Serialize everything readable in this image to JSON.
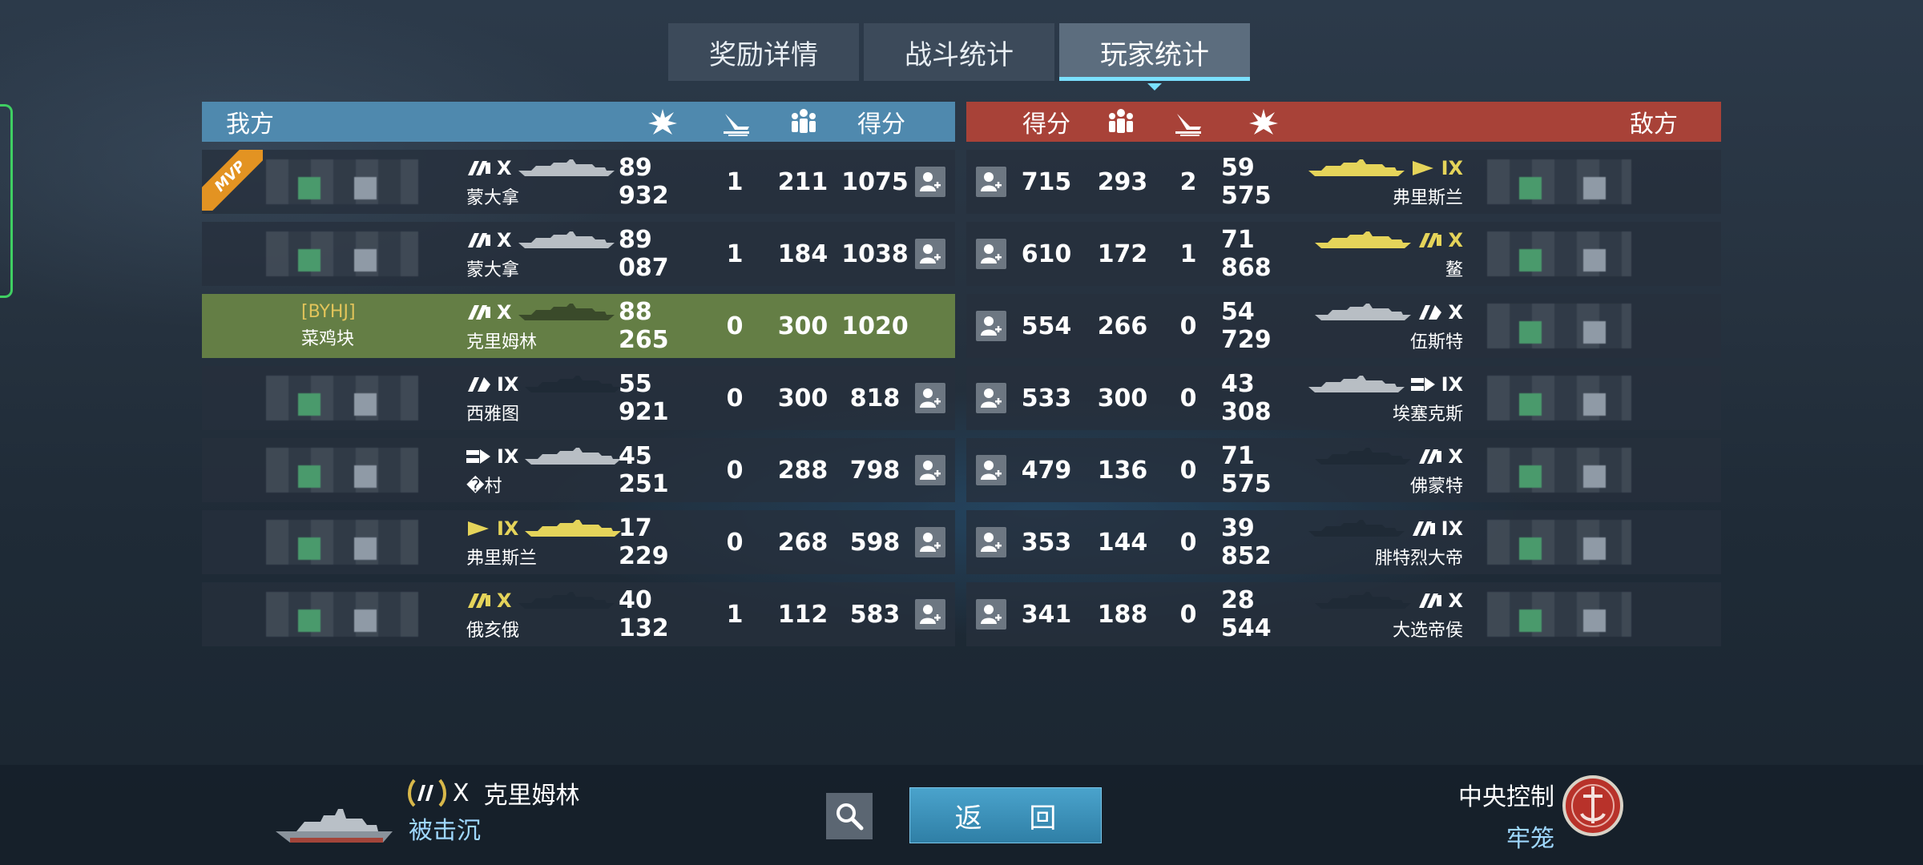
{
  "tabs": [
    {
      "label": "奖励详情",
      "active": false
    },
    {
      "label": "战斗统计",
      "active": false
    },
    {
      "label": "玩家统计",
      "active": true
    }
  ],
  "ally": {
    "title": "我方",
    "score_label": "得分",
    "rows": [
      {
        "mvp": true,
        "mvp_label": "MVP",
        "clan": "",
        "player": "",
        "ship_class": "double-slash",
        "tier": "X",
        "ship": "蒙大拿",
        "ship_color": "#b8bec4",
        "damage": "89 932",
        "kills": "1",
        "spotting": "211",
        "score": "1075",
        "self": false,
        "class_color": "#ffffff"
      },
      {
        "mvp": false,
        "clan": "",
        "player": "",
        "ship_class": "double-slash",
        "tier": "X",
        "ship": "蒙大拿",
        "ship_color": "#b8bec4",
        "damage": "89 087",
        "kills": "1",
        "spotting": "184",
        "score": "1038",
        "self": false,
        "class_color": "#ffffff"
      },
      {
        "mvp": false,
        "clan": "[BYHJ]",
        "player": "菜鸡块",
        "ship_class": "double-slash",
        "tier": "X",
        "ship": "克里姆林",
        "ship_color": "#3a4a2a",
        "damage": "88 265",
        "kills": "0",
        "spotting": "300",
        "score": "1020",
        "self": true,
        "class_color": "#ffffff"
      },
      {
        "mvp": false,
        "clan": "",
        "player": "",
        "ship_class": "single-slash",
        "tier": "IX",
        "ship": "西雅图",
        "ship_color": "#1f2a36",
        "damage": "55 921",
        "kills": "0",
        "spotting": "300",
        "score": "818",
        "self": false,
        "class_color": "#ffffff"
      },
      {
        "mvp": false,
        "clan": "",
        "player": "",
        "ship_class": "arrow",
        "tier": "IX",
        "ship": "�村",
        "ship_color": "#b8bec4",
        "damage": "45 251",
        "kills": "0",
        "spotting": "288",
        "score": "798",
        "self": false,
        "class_color": "#ffffff"
      },
      {
        "mvp": false,
        "clan": "",
        "player": "",
        "ship_class": "triangle",
        "tier": "IX",
        "ship": "弗里斯兰",
        "ship_color": "#e5d45a",
        "damage": "17 229",
        "kills": "0",
        "spotting": "268",
        "score": "598",
        "self": false,
        "class_color": "#e5d45a"
      },
      {
        "mvp": false,
        "clan": "",
        "player": "",
        "ship_class": "double-slash",
        "tier": "X",
        "ship": "俄亥俄",
        "ship_color": "#1f2a36",
        "damage": "40 132",
        "kills": "1",
        "spotting": "112",
        "score": "583",
        "self": false,
        "class_color": "#e5d45a"
      }
    ]
  },
  "enemy": {
    "title": "敌方",
    "score_label": "得分",
    "rows": [
      {
        "score": "715",
        "spotting": "293",
        "kills": "2",
        "damage": "59 575",
        "ship_class": "triangle",
        "tier": "IX",
        "ship": "弗里斯兰",
        "ship_color": "#e5d45a",
        "class_color": "#e5d45a"
      },
      {
        "score": "610",
        "spotting": "172",
        "kills": "1",
        "damage": "71 868",
        "ship_class": "double-slash",
        "tier": "X",
        "ship": "鳌",
        "ship_color": "#e5d45a",
        "class_color": "#e5d45a"
      },
      {
        "score": "554",
        "spotting": "266",
        "kills": "0",
        "damage": "54 729",
        "ship_class": "single-slash",
        "tier": "X",
        "ship": "伍斯特",
        "ship_color": "#b8bec4",
        "class_color": "#ffffff"
      },
      {
        "score": "533",
        "spotting": "300",
        "kills": "0",
        "damage": "43 308",
        "ship_class": "arrow",
        "tier": "IX",
        "ship": "埃塞克斯",
        "ship_color": "#b8bec4",
        "class_color": "#ffffff"
      },
      {
        "score": "479",
        "spotting": "136",
        "kills": "0",
        "damage": "71 575",
        "ship_class": "double-slash",
        "tier": "X",
        "ship": "佛蒙特",
        "ship_color": "#1f2a36",
        "class_color": "#ffffff"
      },
      {
        "score": "353",
        "spotting": "144",
        "kills": "0",
        "damage": "39 852",
        "ship_class": "double-slash",
        "tier": "IX",
        "ship": "腓特烈大帝",
        "ship_color": "#1f2a36",
        "class_color": "#ffffff"
      },
      {
        "score": "341",
        "spotting": "188",
        "kills": "0",
        "damage": "28 544",
        "ship_class": "double-slash",
        "tier": "X",
        "ship": "大选帝侯",
        "ship_color": "#1f2a36",
        "class_color": "#ffffff"
      }
    ]
  },
  "footer": {
    "my_ship_tier": "X",
    "my_ship_name": "克里姆林",
    "my_status": "被击沉",
    "back_label": "返 回",
    "mode_name": "中央控制",
    "mode_map": "牢笼"
  },
  "colors": {
    "ally_header": "#4f89ae",
    "enemy_header": "#a84238",
    "self_row": "#647e45",
    "tab_active_underline": "#7ae0ff",
    "gold": "#e5d45a"
  }
}
